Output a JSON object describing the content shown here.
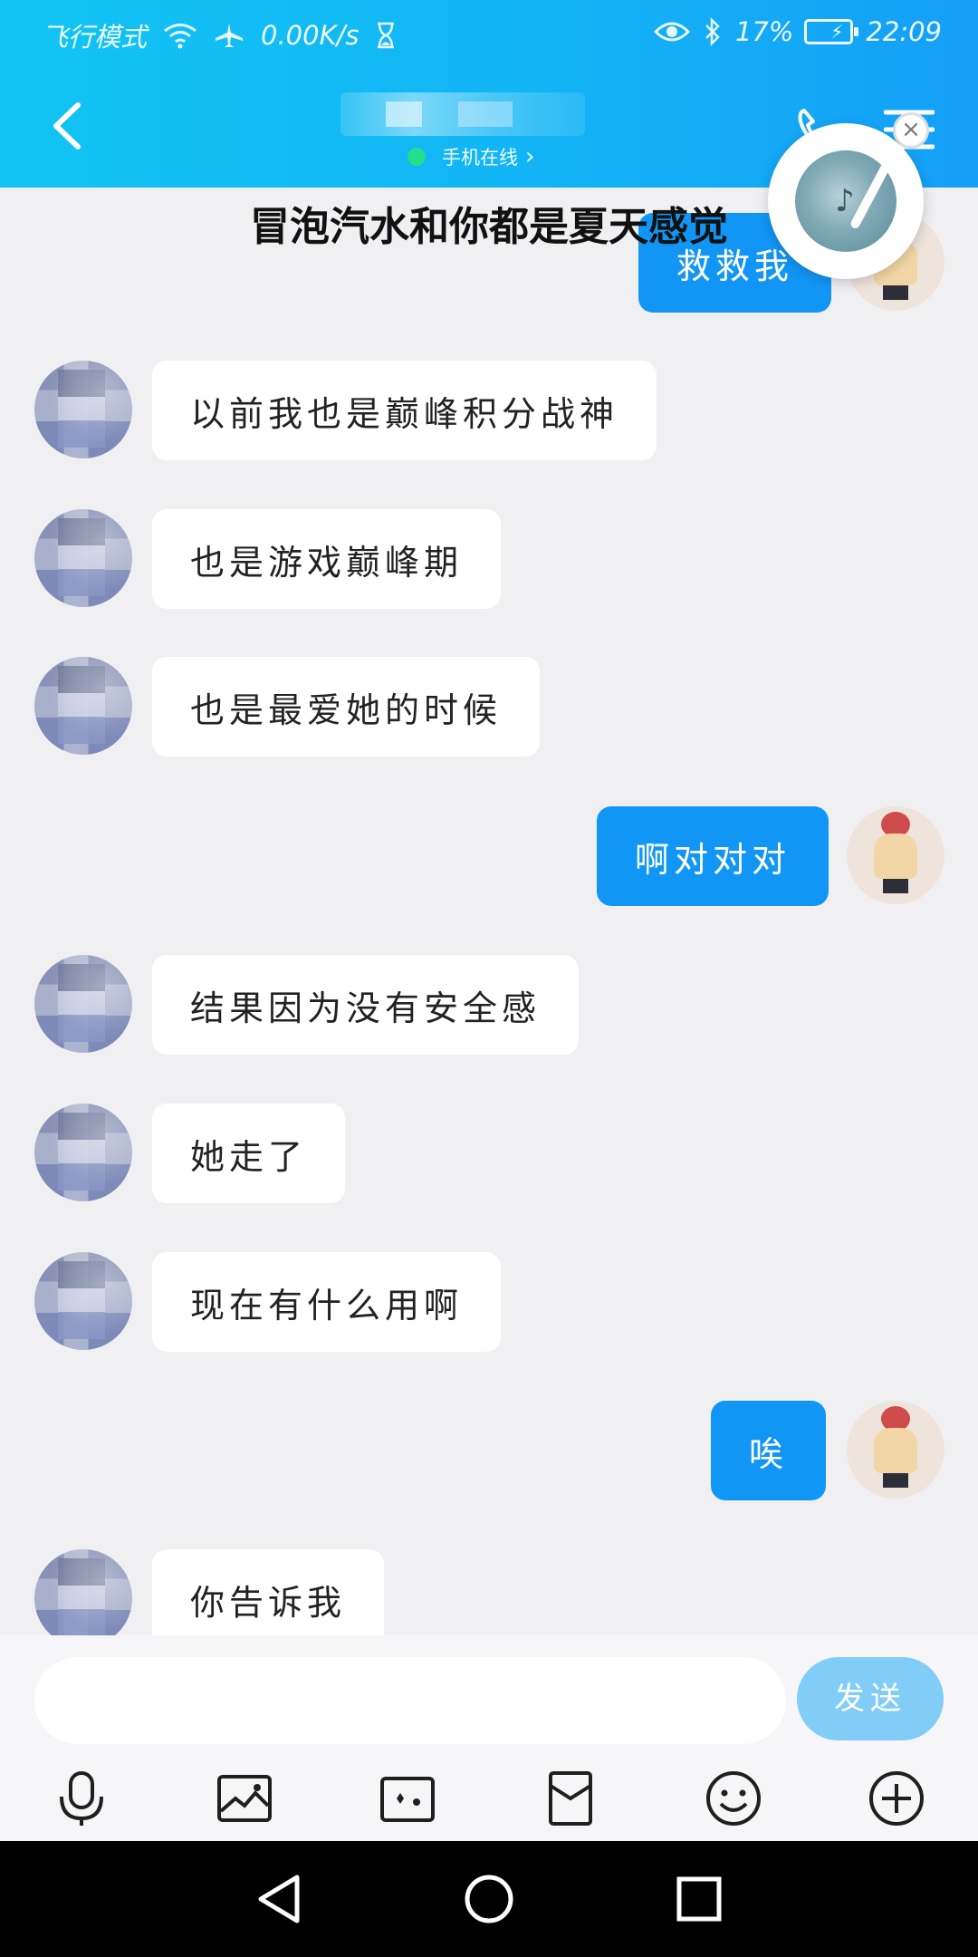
{
  "status_bar": {
    "airplane_label": "飞行模式",
    "speed": "0.00K/s",
    "battery": "17%",
    "time": "22:09",
    "icons": [
      "wifi-icon",
      "airplane-icon",
      "hourglass-icon",
      "eye-icon",
      "bluetooth-icon",
      "battery-icon"
    ]
  },
  "header": {
    "contact_name": "",
    "online_status": "手机在线",
    "online_color": "#22e08b",
    "icons": [
      "back-icon",
      "phone-icon",
      "menu-icon"
    ]
  },
  "music_widget": {
    "lyric": "冒泡汽水和你都是夏天感觉",
    "icons": [
      "music-disc-icon",
      "close-icon"
    ]
  },
  "messages": [
    {
      "side": "out",
      "text": "救救我"
    },
    {
      "side": "in",
      "text": "以前我也是巅峰积分战神"
    },
    {
      "side": "in",
      "text": "也是游戏巅峰期"
    },
    {
      "side": "in",
      "text": "也是最爱她的时候"
    },
    {
      "side": "out",
      "text": "啊对对对"
    },
    {
      "side": "in",
      "text": "结果因为没有安全感"
    },
    {
      "side": "in",
      "text": "她走了"
    },
    {
      "side": "in",
      "text": "现在有什么用啊"
    },
    {
      "side": "out",
      "text": "唉"
    },
    {
      "side": "in",
      "text": "你告诉我"
    }
  ],
  "input": {
    "placeholder": "",
    "value": "",
    "send_label": "发送"
  },
  "toolbar": {
    "icons": [
      "microphone-icon",
      "image-icon",
      "camera-icon",
      "red-packet-icon",
      "emoji-icon",
      "plus-icon"
    ]
  },
  "nav_bar": {
    "icons": [
      "nav-back-icon",
      "nav-home-icon",
      "nav-recent-icon"
    ]
  },
  "colors": {
    "header_gradient_start": "#12c4f3",
    "header_gradient_end": "#159ff7",
    "outgoing_bubble": "#1296f6",
    "incoming_bubble": "#ffffff",
    "send_button": "#82cdf8",
    "background": "#f0f0f2"
  }
}
